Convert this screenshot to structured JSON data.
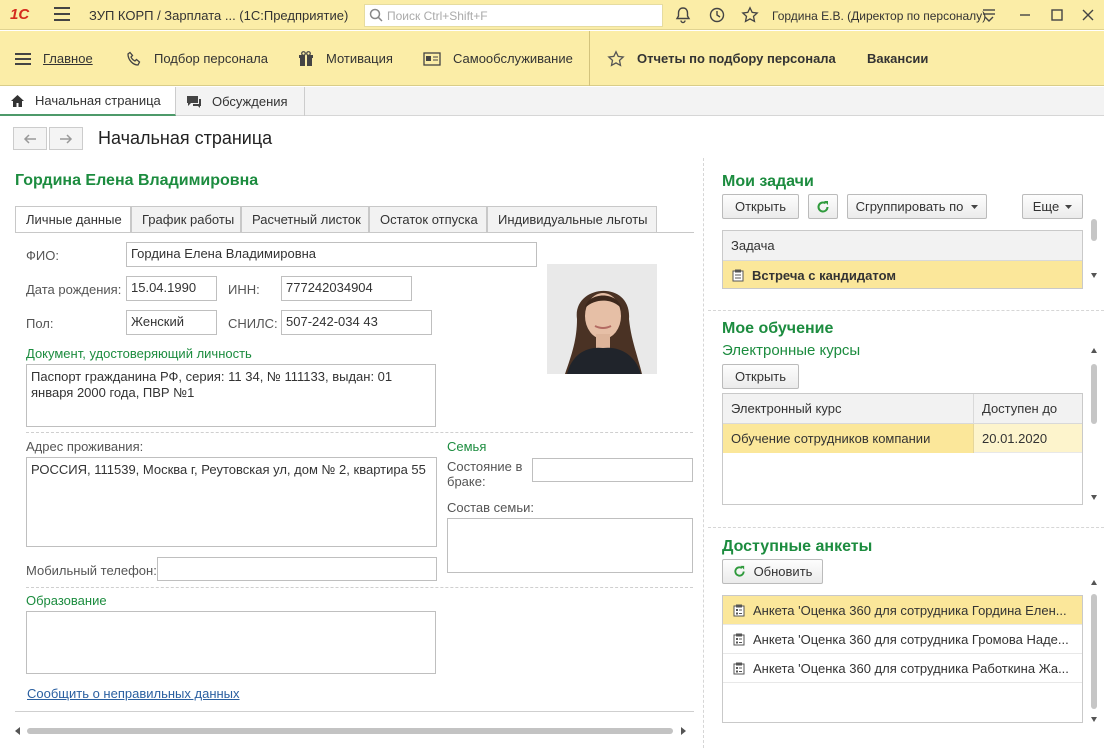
{
  "titlebar": {
    "logo": "1С",
    "title": "ЗУП КОРП / Зарплата ...  (1С:Предприятие)",
    "search_placeholder": "Поиск Ctrl+Shift+F",
    "user": "Гордина Е.В. (Директор по персоналу)"
  },
  "sections": {
    "items": [
      {
        "label": "Главное",
        "icon": "menu-icon"
      },
      {
        "label": "Подбор персонала",
        "icon": "phone-icon"
      },
      {
        "label": "Мотивация",
        "icon": "gift-icon"
      },
      {
        "label": "Самообслуживание",
        "icon": "card-icon"
      }
    ],
    "favorites": [
      {
        "label": "Отчеты по подбору персонала"
      },
      {
        "label": "Вакансии"
      }
    ]
  },
  "open_tabs": [
    {
      "label": "Начальная страница",
      "icon": "home-icon"
    },
    {
      "label": "Обсуждения",
      "icon": "chat-icon"
    }
  ],
  "page": {
    "title": "Начальная страница",
    "employee_name": "Гордина Елена Владимировна"
  },
  "form_tabs": [
    "Личные данные",
    "График работы",
    "Расчетный листок",
    "Остаток отпуска",
    "Индивидуальные льготы"
  ],
  "personal": {
    "fio_label": "ФИО:",
    "fio": "Гордина Елена Владимировна",
    "birth_label": "Дата рождения:",
    "birth": "15.04.1990",
    "inn_label": "ИНН:",
    "inn": "777242034904",
    "sex_label": "Пол:",
    "sex": "Женский",
    "snils_label": "СНИЛС:",
    "snils": "507-242-034 43",
    "doc_title": "Документ, удостоверяющий личность",
    "doc": "Паспорт гражданина РФ, серия: 11 34, № 111133, выдан: 01 января 2000 года, ПВР №1",
    "address_label": "Адрес проживания:",
    "address": "РОССИЯ, 111539, Москва г, Реутовская ул, дом № 2, квартира 55",
    "family_title": "Семья",
    "marital_label": "Состояние в браке:",
    "marital": "",
    "family_label": "Состав семьи:",
    "family": "",
    "phone_label": "Мобильный телефон:",
    "phone": "",
    "edu_title": "Образование",
    "edu": "",
    "report_link": "Сообщить о неправильных данных"
  },
  "tasks": {
    "title": "Мои задачи",
    "open_btn": "Открыть",
    "group_btn": "Сгруппировать по",
    "more_btn": "Еще",
    "col": "Задача",
    "rows": [
      "Встреча с кандидатом"
    ]
  },
  "learning": {
    "title": "Мое обучение",
    "subtitle": "Электронные курсы",
    "open_btn": "Открыть",
    "col_course": "Электронный курс",
    "col_until": "Доступен до",
    "rows": [
      {
        "course": "Обучение сотрудников компании",
        "until": "20.01.2020"
      }
    ]
  },
  "surveys": {
    "title": "Доступные анкеты",
    "refresh_btn": "Обновить",
    "rows": [
      "Анкета 'Оценка 360 для сотрудника Гордина Елен...",
      "Анкета 'Оценка 360 для сотрудника Громова Наде...",
      "Анкета 'Оценка 360 для сотрудника Работкина Жа..."
    ]
  },
  "colors": {
    "accent_green": "#1c8c3f",
    "panel_yellow": "#fbeda7",
    "selection": "#fbe79a"
  }
}
